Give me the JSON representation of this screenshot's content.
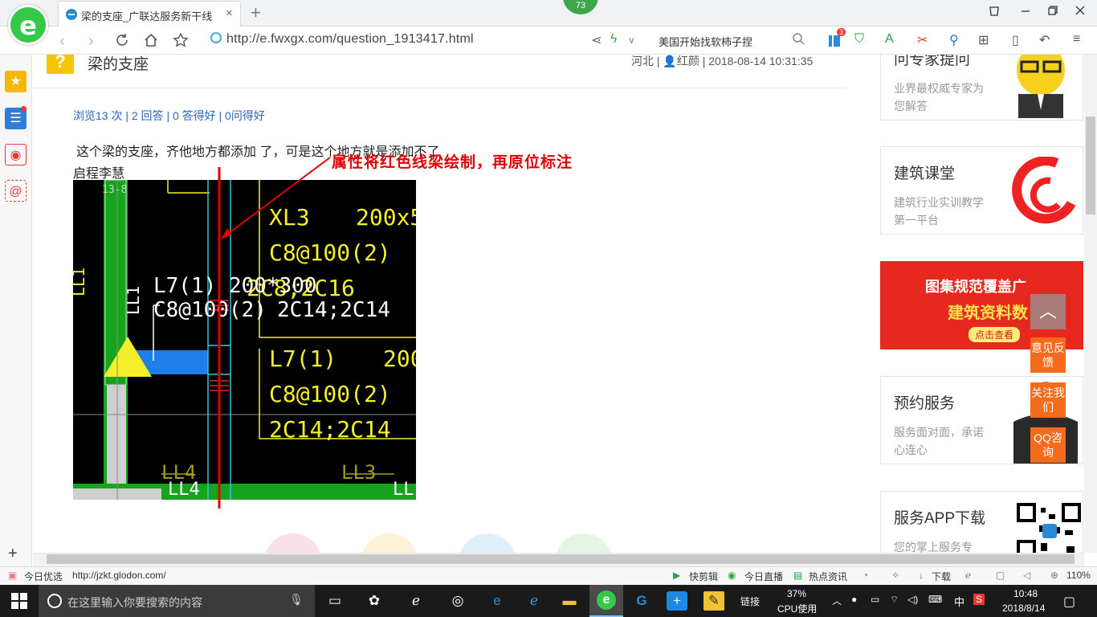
{
  "browser": {
    "tab_title": "梁的支座_广联达服务新干线",
    "tab_close": "×",
    "new_tab": "+",
    "notif_count": "73",
    "url": "http://e.fwxgx.com/question_1913417.html",
    "search_text": "美国开始找软柿子捏",
    "ext_badge": "3",
    "status_url": "http://jzkt.glodon.com/",
    "status_today": "今日优选",
    "status_items": [
      "快剪辑",
      "今日直播",
      "热点资讯",
      "下载"
    ],
    "zoom": "110%"
  },
  "question": {
    "icon": "?",
    "title": "梁的支座",
    "meta": "河北 | 👤红颜 | 2018-08-14 10:31:35",
    "stats": "浏览13 次 | 2 回答 | 0 答得好 | 0问得好",
    "text": "这个梁的支座，齐他地方都添加 了，可是这个地方就是添加不了",
    "text2": "启程李慧",
    "annotation": "属性将红色线梁绘制，再原位标注"
  },
  "cad": {
    "top_label": "13-8",
    "ll1_left": "LL1",
    "ll1": "LL1",
    "xl3": "XL3",
    "xl3_size": "200x5",
    "c8_1": "C8@100(2)",
    "c2c16": "2C8;2C16",
    "l7_a": "L7(1)",
    "size_a": "200*300",
    "c8_a": "C8@100(2)",
    "rebar_a": "2C14;2C14",
    "l7_b": "L7(1)",
    "size_b": "200",
    "c8_b": "C8@100(2)",
    "rebar_b": "2C14;2C14",
    "ll4_a": "LL4",
    "ll4_b": "LL4",
    "ll3": "LL3",
    "ll_right": "LL"
  },
  "sidebar": {
    "cards": [
      {
        "title": "问专家提问",
        "desc": "业界最权威专家为您解答"
      },
      {
        "title": "建筑课堂",
        "desc": "建筑行业实训教学第一平台"
      },
      {
        "title": "",
        "desc": ""
      },
      {
        "title": "预约服务",
        "desc": "服务面对面，承诺心连心"
      },
      {
        "title": "服务APP下载",
        "desc": "您的掌上服务专"
      }
    ],
    "banner_line1": "图集规范覆盖广",
    "banner_line2": "建筑资料数",
    "banner_btn": "点击查看",
    "float_feedback": "意见反馈",
    "float_follow": "关注我们",
    "float_qq": "QQ咨询"
  },
  "taskbar": {
    "search_placeholder": "在这里输入你要搜索的内容",
    "link": "链接",
    "cpu_pct": "37%",
    "cpu_label": "CPU使用",
    "ime": "中",
    "time": "10:48",
    "date": "2018/8/14"
  },
  "colors": {
    "accent_green": "#35c94a",
    "link_blue": "#2866b9",
    "annotation_red": "#e00000",
    "float_orange": "#f56b1c",
    "cad_yellow": "#f4ef2c"
  }
}
